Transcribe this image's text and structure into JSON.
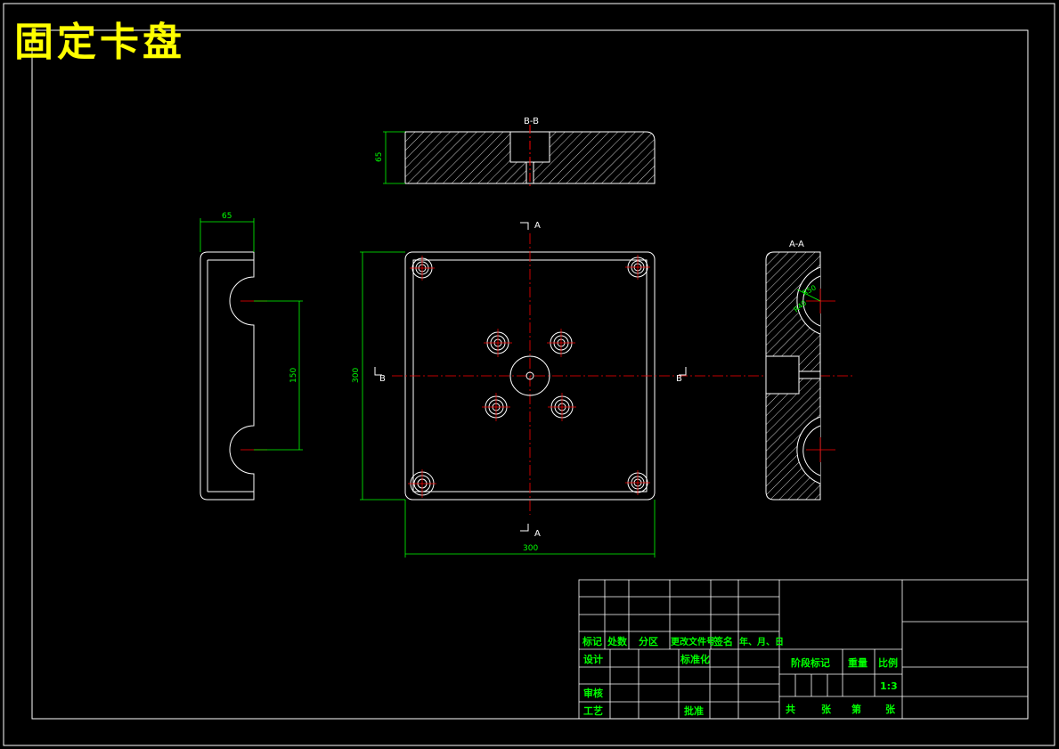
{
  "title": "固定卡盘",
  "colors": {
    "background": "#000000",
    "outline": "#ffffff",
    "dimension": "#00ff00",
    "centerline": "#ff0000",
    "title": "#ffff00",
    "titleblock_text": "#00ff00"
  },
  "views": {
    "section_bb_label": "B-B",
    "section_aa_label": "A-A",
    "cut_a_label": "A",
    "cut_b_label": "B"
  },
  "dimensions": {
    "top_height": "65",
    "side_width": "65",
    "side_span": "150",
    "front_height": "300",
    "front_width": "300",
    "radius_outer": "R50",
    "radius_inner": "R40"
  },
  "title_block": {
    "header_mark": "标记",
    "header_count": "处数",
    "header_zone": "分区",
    "header_doc": "更改文件号",
    "header_sign": "签名",
    "header_date": "年、月、日",
    "design": "设计",
    "standardization": "标准化",
    "stage_mark": "阶段标记",
    "weight": "重量",
    "scale_label": "比例",
    "scale_value": "1:3",
    "review": "审核",
    "process": "工艺",
    "approve": "批准",
    "total": "共",
    "sheets": "张",
    "page": "第",
    "sheet": "张"
  }
}
